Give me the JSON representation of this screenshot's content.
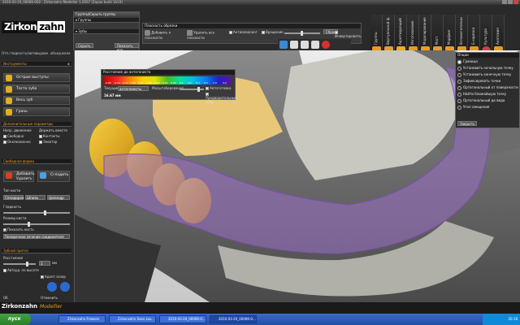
{
  "window": {
    "title": "2010-03-20_00006-002 - Zirkonzahn.Modellier 1.0567 [Zapax build 1619]"
  },
  "brand": {
    "logo_main": "Zirkon",
    "logo_box": "zahn",
    "footer_brand": "Zirkonzahn",
    "footer_product": "Modellier"
  },
  "groups_panel": {
    "title": "Группы/Скрыть группы",
    "row1": "Группы",
    "row2": "Зубы",
    "hide_btn": "Скрыть",
    "show_all_btn": "Показать все"
  },
  "clip_panel": {
    "title": "Плоскость обрезки",
    "add_btn": "Добавить к плоскости",
    "delete_btn": "Удалить все плоскости",
    "antialias": "Антиалиасинг",
    "rotate": "Вращение",
    "reset": "Сброс",
    "invert": "Инвертировать"
  },
  "top_tabs": [
    {
      "label": "Группы",
      "color": "#e89a20"
    },
    {
      "label": "Виртуальный ф.",
      "color": "#e0a030"
    },
    {
      "label": "Адаптирующий",
      "color": "#e8b020"
    },
    {
      "label": "Изготовление",
      "color": "#e0a020"
    },
    {
      "label": "Моделирование",
      "color": "#e8a020"
    },
    {
      "label": "Мост",
      "color": "#e0a030"
    },
    {
      "label": "Морфинг",
      "color": "#e8a020"
    },
    {
      "label": "Вспомогательные",
      "color": "#e0a020"
    },
    {
      "label": "Б нарезка",
      "color": "#e89a20"
    },
    {
      "label": "Культура",
      "color": "#e8a030"
    },
    {
      "label": "Анатомия",
      "color": "#e0a020"
    }
  ],
  "left_panel": {
    "header": "Отп.гладкость/автовыравн. объед.возм.",
    "section_tools": "Инструменты",
    "tools": [
      "Острые выступы",
      "Тесто зуба",
      "Весь зуб",
      "Грань"
    ],
    "section_extra": "Дополнительные параметры",
    "labels": {
      "cap_move": "Напр. движения",
      "hold_down": "Держать вместе",
      "free": "Свободно",
      "contacts": "Контакты",
      "fixed_contact": "Окклюзионно",
      "equator": "Экватор"
    },
    "section_free": "Свободная форма",
    "add_btn": "Добавить Удалить",
    "smooth_btn": "Сгладить",
    "brush": "Тип кисти",
    "brush_opts": [
      "Спендиран",
      "Шпиль",
      "Цилиндр"
    ],
    "smoothness": "Гладкость",
    "brush_size": "Размер кисти",
    "show_brush": "Показать кисть",
    "cross_section": "Поперечное сечение соединителя",
    "section_tooth": "Зубной протез",
    "thickness": "Расстояние",
    "thickness_val": "1",
    "thickness_unit": "мм",
    "auto_remove": "Автоуд. по высоте",
    "apply_btn": "Адапт.зазор",
    "ok": "OK",
    "cancel": "Отменить"
  },
  "distance_panel": {
    "title": "Расстояние до антагониста",
    "ticks": [
      "-0.05",
      "-0.04",
      "-0.03",
      "0.00",
      "0.01",
      "0.02",
      "0.03",
      "0.04",
      "0.05",
      "0.1",
      "0.2",
      "0.3",
      "0.5",
      "1.0",
      "3.0"
    ],
    "value": "16.67 мм",
    "select_label": "Текущие",
    "select_value": "антагонисты",
    "scale_label": "Масштабирование",
    "check1": "Автоготовка",
    "check2": "Предварительные зубы"
  },
  "options_panel": {
    "title": "Опции",
    "items": [
      "Граница",
      "Установить начальную точку",
      "Установить конечную точку",
      "Зафиксировать точки",
      "Ортогональный от поверхности",
      "Найти ближайшую точку",
      "Ортогональный до вида",
      "Угол смещения"
    ],
    "selected": 0,
    "close": "Закрыть"
  },
  "taskbar": {
    "start": "пуск",
    "tasks": [
      "Zirkonzahn.Fraesen",
      "Zirkonzahn Sans zav...",
      "2010-03-20_00006-0...",
      "2010-03-20_00006-0..."
    ],
    "active_task": 3,
    "clock": "20:18"
  }
}
